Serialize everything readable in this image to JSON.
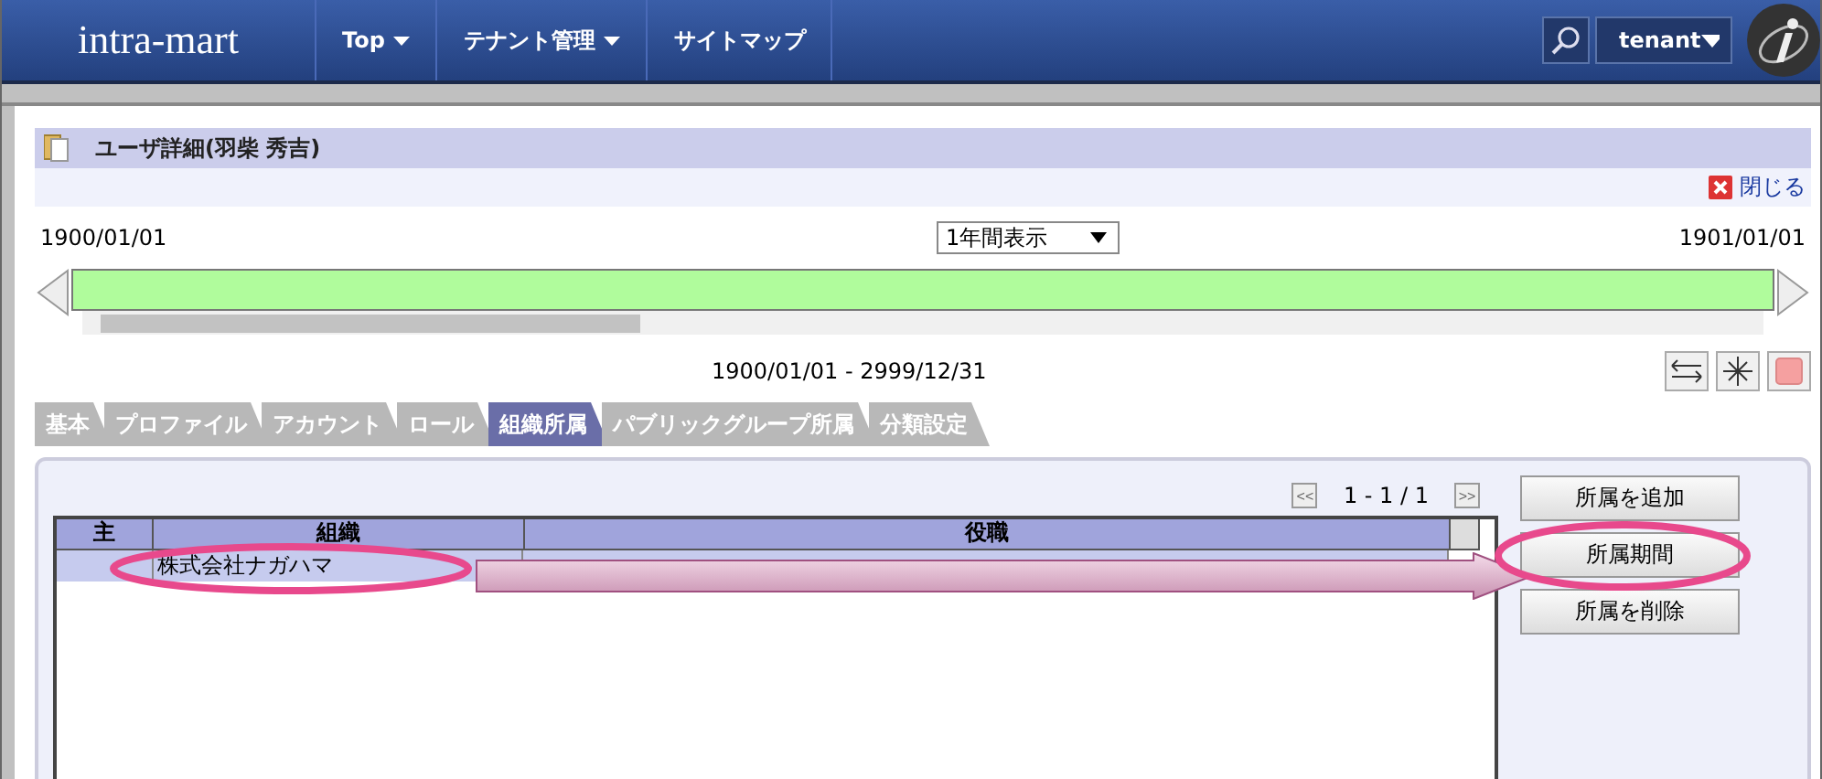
{
  "header": {
    "logo": "intra-mart",
    "nav": [
      {
        "label": "Top",
        "dropdown": true
      },
      {
        "label": "テナント管理",
        "dropdown": true
      },
      {
        "label": "サイトマップ",
        "dropdown": false
      }
    ],
    "user": "tenant"
  },
  "panel": {
    "title": "ユーザ詳細(羽柴 秀吉)",
    "close": "閉じる"
  },
  "timeline": {
    "start": "1900/01/01",
    "end": "1901/01/01",
    "view": "1年間表示",
    "range": "1900/01/01 - 2999/12/31"
  },
  "tabs": [
    {
      "label": "基本",
      "selected": false
    },
    {
      "label": "プロファイル",
      "selected": false
    },
    {
      "label": "アカウント",
      "selected": false
    },
    {
      "label": "ロール",
      "selected": false
    },
    {
      "label": "組織所属",
      "selected": true
    },
    {
      "label": "パブリックグループ所属",
      "selected": false
    },
    {
      "label": "分類設定",
      "selected": false
    }
  ],
  "pager": {
    "prev": "<<",
    "text": "1 - 1 / 1",
    "next": ">>"
  },
  "table": {
    "columns": [
      "主",
      "組織",
      "役職"
    ],
    "rows": [
      [
        "",
        "株式会社ナガハマ",
        ""
      ]
    ]
  },
  "buttons": [
    "所属を追加",
    "所属期間",
    "所属を削除"
  ]
}
